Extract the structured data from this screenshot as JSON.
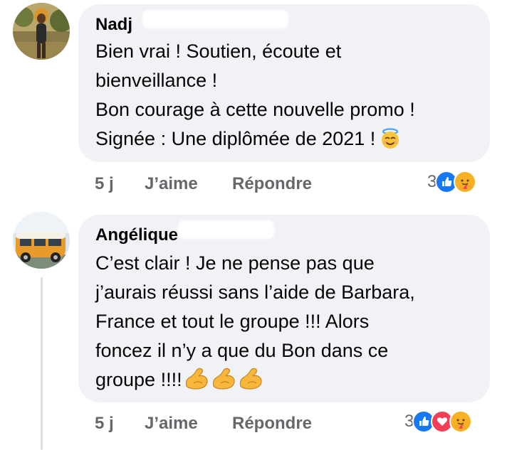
{
  "comments": [
    {
      "author": "Nadj",
      "lines": [
        "Bien vrai ! Soutien, écoute et",
        "bienveillance !",
        "Bon courage à cette nouvelle promo !",
        "Signée : Une diplômée de 2021 !"
      ],
      "emoji": "smiling-face-with-halo",
      "time": "5 j",
      "like_label": "J’aime",
      "reply_label": "Répondre",
      "reaction_count": "3",
      "reactions": [
        "like",
        "care"
      ]
    },
    {
      "author": "Angélique",
      "lines": [
        "C’est clair ! Je ne pense pas que",
        "j’aurais réussi sans l’aide de Barbara,",
        "France et tout le groupe !!! Alors",
        "foncez il n’y a que du Bon dans ce",
        "groupe !!!!"
      ],
      "emoji": "flexed-biceps-x3",
      "time": "5 j",
      "like_label": "J’aime",
      "reply_label": "Répondre",
      "reaction_count": "3",
      "reactions": [
        "like",
        "love",
        "care"
      ]
    }
  ],
  "colors": {
    "bubble": "#f0f2f5",
    "meta": "#65676b",
    "like": "#1877f2",
    "love": "#f33e58",
    "care": "#f7b125"
  }
}
